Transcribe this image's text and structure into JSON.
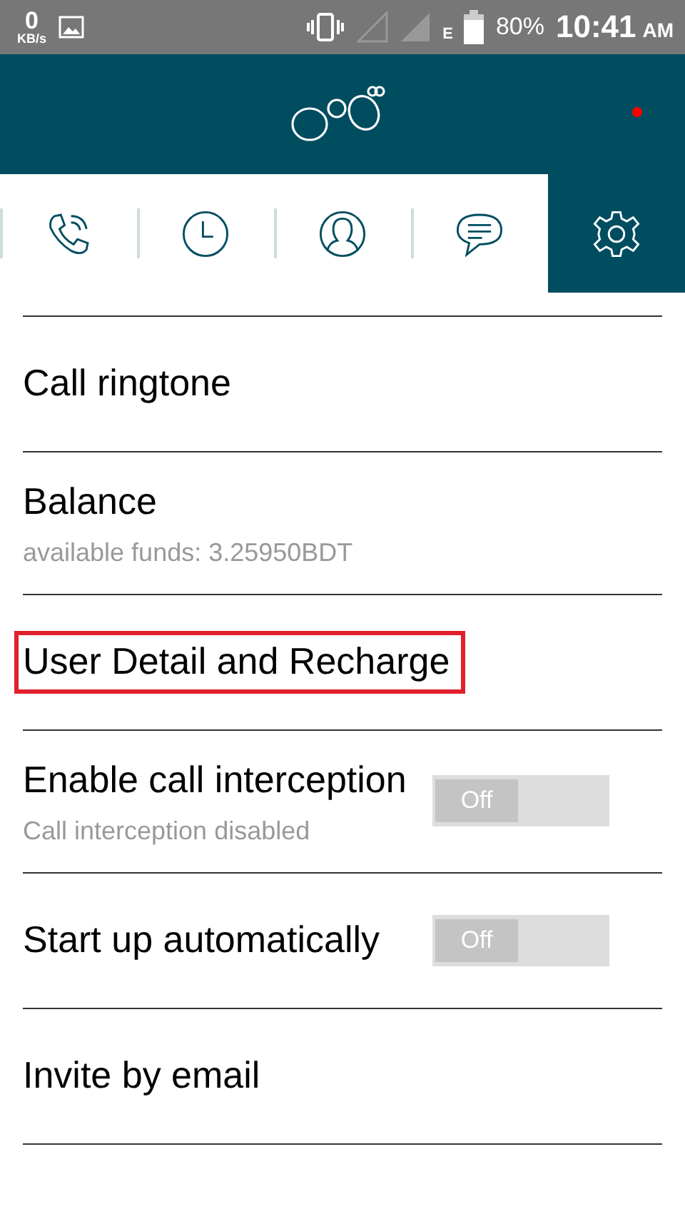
{
  "status_bar": {
    "speed": "0",
    "speed_unit": "KB/s",
    "network_type": "E",
    "battery": "80%",
    "time": "10:41",
    "ampm": "AM"
  },
  "header": {
    "notification_dot": true
  },
  "tabs": [
    {
      "kind": "calls",
      "selected": false
    },
    {
      "kind": "history",
      "selected": false
    },
    {
      "kind": "contacts",
      "selected": false
    },
    {
      "kind": "chat",
      "selected": false
    },
    {
      "kind": "settings",
      "selected": true
    }
  ],
  "settings": [
    {
      "title": "Call ringtone",
      "highlighted": false
    },
    {
      "title": "Balance",
      "summary": "available funds: 3.25950BDT",
      "highlighted": false
    },
    {
      "title": "User Detail and Recharge",
      "highlighted": true
    },
    {
      "title": "Enable call interception",
      "summary": "Call interception disabled",
      "highlighted": false,
      "toggle": {
        "on": false,
        "label": "Off"
      }
    },
    {
      "title": "Start up automatically",
      "highlighted": false,
      "toggle": {
        "on": false,
        "label": "Off"
      }
    },
    {
      "title": "Invite by email",
      "highlighted": false
    }
  ]
}
